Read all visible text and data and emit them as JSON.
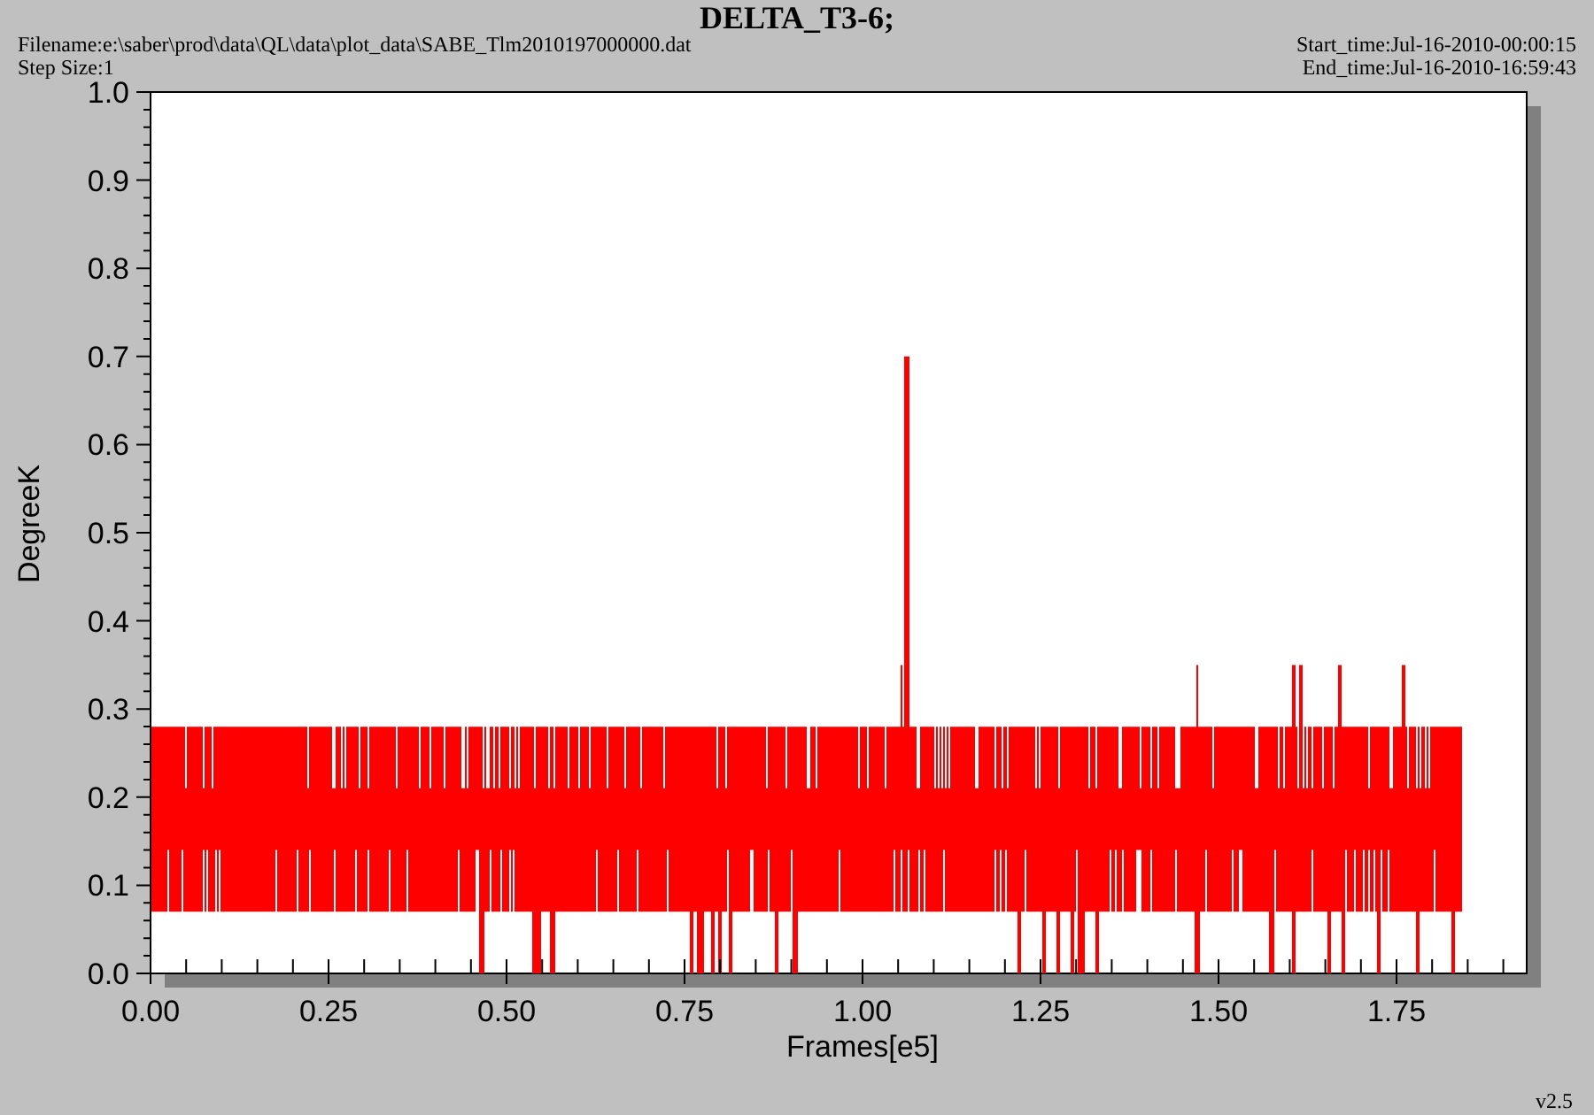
{
  "title": "DELTA_T3-6;",
  "filename": "Filename:e:\\saber\\prod\\data\\QL\\data\\plot_data\\SABE_Tlm2010197000000.dat",
  "start_time": "Start_time:Jul-16-2010-00:00:15",
  "step_size": "Step Size:1",
  "end_time": "End_time:Jul-16-2010-16:59:43",
  "y_label": "DegreeK",
  "x_label": "Frames[e5]",
  "y_ticks": [
    "1.0",
    "0.9",
    "0.8",
    "0.7",
    "0.6",
    "0.5",
    "0.4",
    "0.3",
    "0.2",
    "0.1",
    "0.0"
  ],
  "x_ticks": [
    "0.00",
    "0.25",
    "0.50",
    "0.75",
    "1.00",
    "1.25",
    "1.50",
    "1.75"
  ],
  "version": "v2.5"
}
